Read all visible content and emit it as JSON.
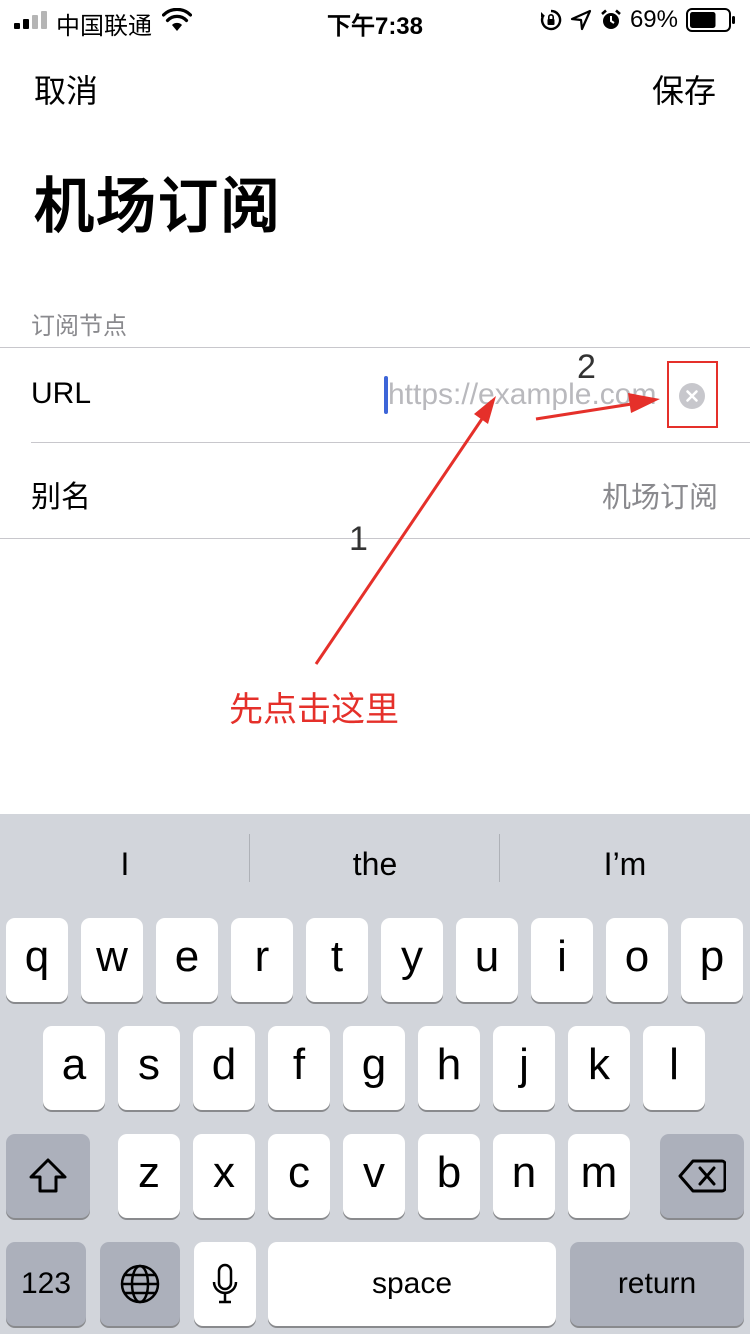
{
  "status_bar": {
    "carrier": "中国联通",
    "time": "下午7:38",
    "battery_percent": "69%",
    "battery_level": 0.69
  },
  "nav": {
    "cancel": "取消",
    "save": "保存"
  },
  "title": "机场订阅",
  "section_header": "订阅节点",
  "rows": {
    "url": {
      "label": "URL",
      "placeholder": "https://example.com"
    },
    "alias": {
      "label": "别名",
      "value": "机场订阅"
    }
  },
  "annotations": {
    "step1": "1",
    "step2": "2",
    "instruction": "先点击这里",
    "color": "#e5302a"
  },
  "keyboard": {
    "suggestions": [
      "I",
      "the",
      "I’m"
    ],
    "row1": [
      "q",
      "w",
      "e",
      "r",
      "t",
      "y",
      "u",
      "i",
      "o",
      "p"
    ],
    "row2": [
      "a",
      "s",
      "d",
      "f",
      "g",
      "h",
      "j",
      "k",
      "l"
    ],
    "row3": [
      "z",
      "x",
      "c",
      "v",
      "b",
      "n",
      "m"
    ],
    "numbers_key": "123",
    "space_key": "space",
    "return_key": "return"
  },
  "icons": {
    "signal": "signal-bars-icon",
    "wifi": "wifi-icon",
    "orientation_lock": "orientation-lock-icon",
    "location": "location-arrow-icon",
    "alarm": "alarm-clock-icon",
    "battery": "battery-icon",
    "clear": "clear-circle-icon",
    "shift": "shift-arrow-icon",
    "delete": "backspace-icon",
    "globe": "globe-icon",
    "mic": "microphone-icon"
  }
}
